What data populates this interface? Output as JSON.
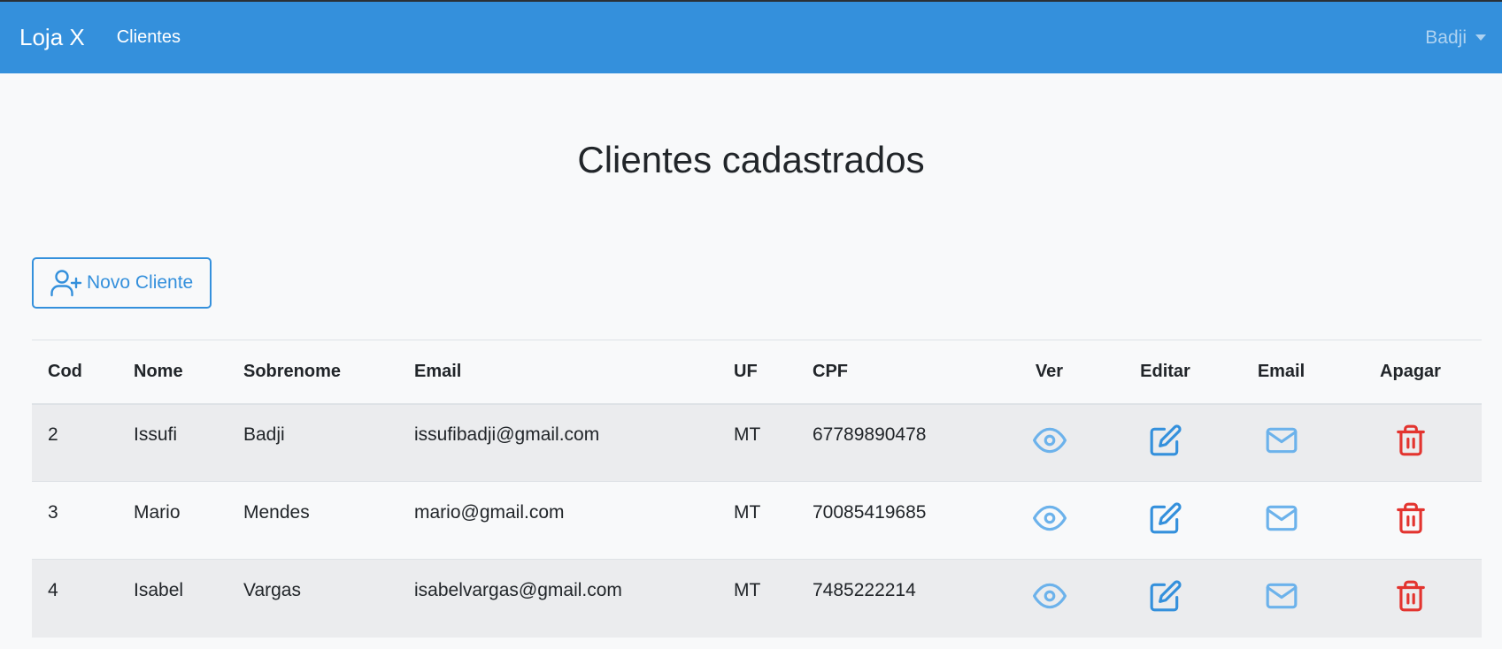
{
  "navbar": {
    "brand": "Loja X",
    "link_clientes": "Clientes",
    "user": "Badji"
  },
  "page": {
    "title": "Clientes cadastrados",
    "new_button_label": "Novo Cliente"
  },
  "table": {
    "headers": {
      "cod": "Cod",
      "nome": "Nome",
      "sobrenome": "Sobrenome",
      "email": "Email",
      "uf": "UF",
      "cpf": "CPF",
      "ver": "Ver",
      "editar": "Editar",
      "email_action": "Email",
      "apagar": "Apagar"
    },
    "rows": [
      {
        "cod": "2",
        "nome": "Issufi",
        "sobrenome": "Badji",
        "email": "issufibadji@gmail.com",
        "uf": "MT",
        "cpf": "67789890478"
      },
      {
        "cod": "3",
        "nome": "Mario",
        "sobrenome": "Mendes",
        "email": "mario@gmail.com",
        "uf": "MT",
        "cpf": "70085419685"
      },
      {
        "cod": "4",
        "nome": "Isabel",
        "sobrenome": "Vargas",
        "email": "isabelvargas@gmail.com",
        "uf": "MT",
        "cpf": "7485222214"
      }
    ],
    "icons": {
      "view": "eye-icon",
      "edit": "edit-icon",
      "mail": "envelope-icon",
      "delete": "trash-icon"
    }
  },
  "colors": {
    "primary": "#3490dc",
    "info": "#6cb2eb",
    "danger": "#e3342f",
    "background": "#f8f9fa"
  }
}
